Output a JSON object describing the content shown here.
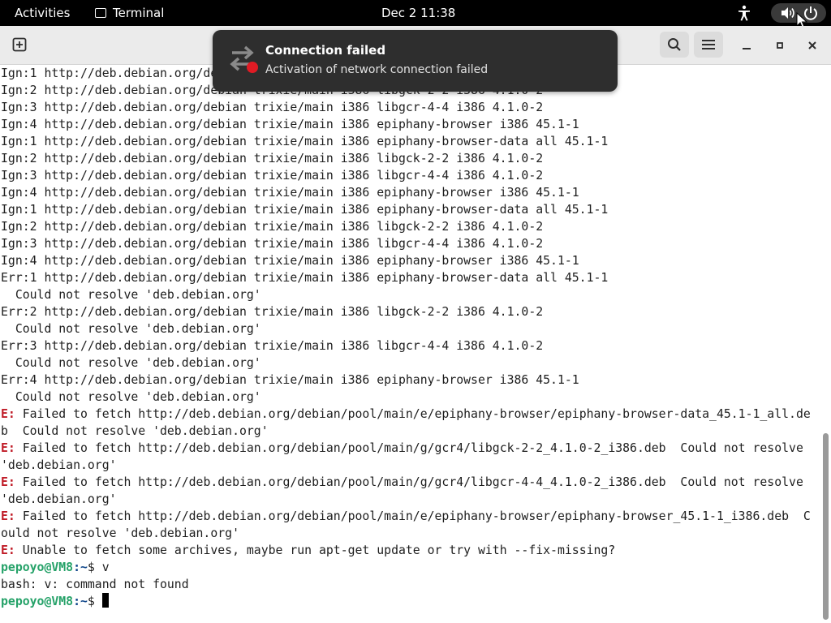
{
  "topbar": {
    "activities": "Activities",
    "app_name": "Terminal",
    "clock": "Dec 2  11:38"
  },
  "notification": {
    "title": "Connection failed",
    "body": "Activation of network connection failed"
  },
  "terminal": {
    "lines": [
      {
        "t": "Ign:1 http://deb.debian.org/debian trixie/main i386 epiphany-browser-data all 45.1-1"
      },
      {
        "t": "Ign:2 http://deb.debian.org/debian trixie/main i386 libgck-2-2 i386 4.1.0-2"
      },
      {
        "t": "Ign:3 http://deb.debian.org/debian trixie/main i386 libgcr-4-4 i386 4.1.0-2"
      },
      {
        "t": "Ign:4 http://deb.debian.org/debian trixie/main i386 epiphany-browser i386 45.1-1"
      },
      {
        "t": "Ign:1 http://deb.debian.org/debian trixie/main i386 epiphany-browser-data all 45.1-1"
      },
      {
        "t": "Ign:2 http://deb.debian.org/debian trixie/main i386 libgck-2-2 i386 4.1.0-2"
      },
      {
        "t": "Ign:3 http://deb.debian.org/debian trixie/main i386 libgcr-4-4 i386 4.1.0-2"
      },
      {
        "t": "Ign:4 http://deb.debian.org/debian trixie/main i386 epiphany-browser i386 45.1-1"
      },
      {
        "t": "Ign:1 http://deb.debian.org/debian trixie/main i386 epiphany-browser-data all 45.1-1"
      },
      {
        "t": "Ign:2 http://deb.debian.org/debian trixie/main i386 libgck-2-2 i386 4.1.0-2"
      },
      {
        "t": "Ign:3 http://deb.debian.org/debian trixie/main i386 libgcr-4-4 i386 4.1.0-2"
      },
      {
        "t": "Ign:4 http://deb.debian.org/debian trixie/main i386 epiphany-browser i386 45.1-1"
      },
      {
        "t": "Err:1 http://deb.debian.org/debian trixie/main i386 epiphany-browser-data all 45.1-1"
      },
      {
        "t": "  Could not resolve 'deb.debian.org'"
      },
      {
        "t": "Err:2 http://deb.debian.org/debian trixie/main i386 libgck-2-2 i386 4.1.0-2"
      },
      {
        "t": "  Could not resolve 'deb.debian.org'"
      },
      {
        "t": "Err:3 http://deb.debian.org/debian trixie/main i386 libgcr-4-4 i386 4.1.0-2"
      },
      {
        "t": "  Could not resolve 'deb.debian.org'"
      },
      {
        "t": "Err:4 http://deb.debian.org/debian trixie/main i386 epiphany-browser i386 45.1-1"
      },
      {
        "t": "  Could not resolve 'deb.debian.org'"
      },
      {
        "e": "E:",
        "t": " Failed to fetch http://deb.debian.org/debian/pool/main/e/epiphany-browser/epiphany-browser-data_45.1-1_all.de"
      },
      {
        "t": "b  Could not resolve 'deb.debian.org'"
      },
      {
        "e": "E:",
        "t": " Failed to fetch http://deb.debian.org/debian/pool/main/g/gcr4/libgck-2-2_4.1.0-2_i386.deb  Could not resolve"
      },
      {
        "t": "'deb.debian.org'"
      },
      {
        "e": "E:",
        "t": " Failed to fetch http://deb.debian.org/debian/pool/main/g/gcr4/libgcr-4-4_4.1.0-2_i386.deb  Could not resolve"
      },
      {
        "t": "'deb.debian.org'"
      },
      {
        "e": "E:",
        "t": " Failed to fetch http://deb.debian.org/debian/pool/main/e/epiphany-browser/epiphany-browser_45.1-1_i386.deb  C"
      },
      {
        "t": "ould not resolve 'deb.debian.org'"
      },
      {
        "e": "E:",
        "t": " Unable to fetch some archives, maybe run apt-get update or try with --fix-missing?"
      },
      {
        "u": "pepoyo@VM8",
        "p": ":~",
        "t": "$ v"
      },
      {
        "t": "bash: v: command not found"
      },
      {
        "u": "pepoyo@VM8",
        "p": ":~",
        "t": "$ ",
        "cursor": true
      }
    ]
  }
}
